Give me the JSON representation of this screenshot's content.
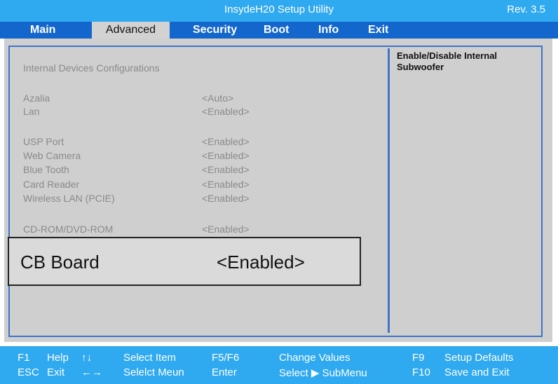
{
  "title_bar": {
    "title": "InsydeH20 Setup Utility",
    "revision": "Rev. 3.5"
  },
  "menu": {
    "items": [
      "Main",
      "Advanced",
      "Security",
      "Boot",
      "Info",
      "Exit"
    ],
    "active": "Advanced"
  },
  "panel": {
    "section_title": "Internal Devices Configurations",
    "rows": [
      {
        "label": "Azalia",
        "value": "<Auto>"
      },
      {
        "label": "Lan",
        "value": "<Enabled>"
      },
      {
        "label": "USP Port",
        "value": "<Enabled>"
      },
      {
        "label": "Web Camera",
        "value": "<Enabled>"
      },
      {
        "label": "Blue Tooth",
        "value": "<Enabled>"
      },
      {
        "label": "Card Reader",
        "value": "<Enabled>"
      },
      {
        "label": "Wireless LAN (PCIE)",
        "value": "<Enabled>"
      },
      {
        "label": "CD-ROM/DVD-ROM",
        "value": "<Enabled>"
      }
    ],
    "highlighted": {
      "label": "CB Board",
      "value": "<Enabled>"
    },
    "help_text": "Enable/Disable Internal Subwoofer"
  },
  "footer": {
    "row1": [
      {
        "key": "F1",
        "desc": "Help"
      },
      {
        "key": "↑↓",
        "desc": "Select Item"
      },
      {
        "key": "F5/F6",
        "desc": "Change Values"
      },
      {
        "key": "F9",
        "desc": "Setup Defaults"
      }
    ],
    "row2": [
      {
        "key": "ESC",
        "desc": "Exit"
      },
      {
        "key": "←→",
        "desc": "Selelct Meun"
      },
      {
        "key": "Enter",
        "desc": "Select ▶ SubMenu"
      },
      {
        "key": "F10",
        "desc": "Save and Exit"
      }
    ]
  },
  "colors": {
    "title_bar": "#2FA9F0",
    "menu_bar": "#1266CC",
    "panel": "#CFCFCF",
    "frame": "#3D74C8"
  }
}
